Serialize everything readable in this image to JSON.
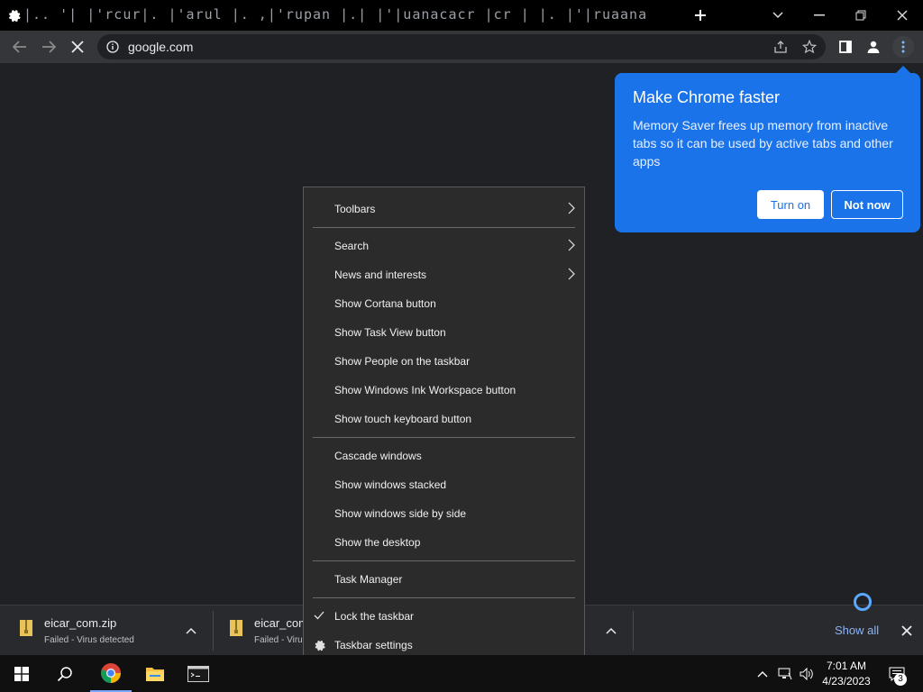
{
  "tabstrip": {
    "tab_title": "|.. '| |'rcur|. |'arul |. ,|'rupan |.| |'|uanacacr |cr | |. |'|ruaana|u"
  },
  "toolbar": {
    "url": "google.com"
  },
  "promo": {
    "title": "Make Chrome faster",
    "body": "Memory Saver frees up memory from inactive tabs so it can be used by active tabs and other apps",
    "turn_on": "Turn on",
    "not_now": "Not now"
  },
  "downloads": {
    "items": [
      {
        "name": "eicar_com.zip",
        "status": "Failed - Virus detected"
      },
      {
        "name": "eicar_com",
        "status": "Failed - Virus"
      }
    ],
    "show_all": "Show all"
  },
  "context_menu": {
    "items": [
      {
        "label": "Toolbars",
        "submenu": true
      },
      {
        "label": "Search",
        "submenu": true
      },
      {
        "label": "News and interests",
        "submenu": true
      },
      {
        "label": "Show Cortana button"
      },
      {
        "label": "Show Task View button"
      },
      {
        "label": "Show People on the taskbar"
      },
      {
        "label": "Show Windows Ink Workspace button"
      },
      {
        "label": "Show touch keyboard button"
      },
      {
        "label": "Cascade windows"
      },
      {
        "label": "Show windows stacked"
      },
      {
        "label": "Show windows side by side"
      },
      {
        "label": "Show the desktop"
      },
      {
        "label": "Task Manager"
      },
      {
        "label": "Lock the taskbar",
        "checked": true
      },
      {
        "label": "Taskbar settings",
        "icon": "gear-icon"
      }
    ]
  },
  "taskbar": {
    "time": "7:01 AM",
    "date": "4/23/2023",
    "notification_count": "3"
  },
  "colors": {
    "accent": "#1a73e8",
    "menu_bg": "#2b2b2b",
    "toolbar_bg": "#35363a"
  }
}
